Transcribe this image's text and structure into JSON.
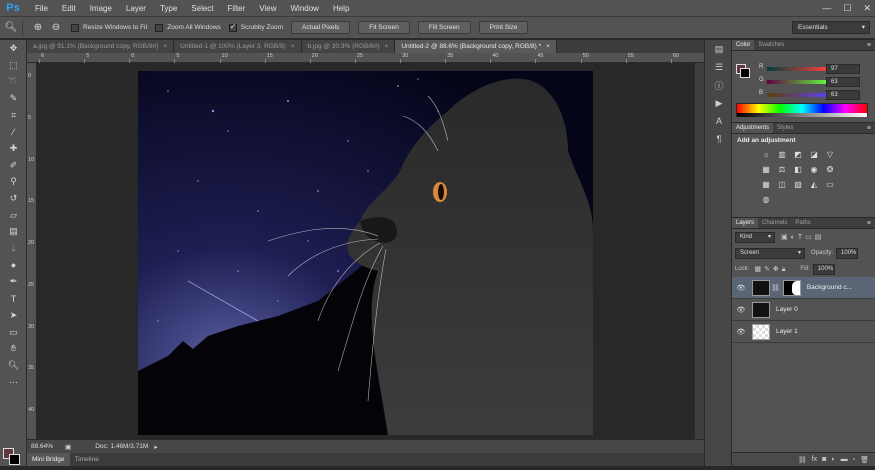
{
  "app": {
    "logo": "Ps"
  },
  "menu": [
    "File",
    "Edit",
    "Image",
    "Layer",
    "Type",
    "Select",
    "Filter",
    "View",
    "Window",
    "Help"
  ],
  "window_controls": {
    "minimize": "—",
    "maximize": "☐",
    "close": "✕"
  },
  "options": {
    "resize_windows": {
      "label": "Resize Windows to Fit",
      "checked": false
    },
    "zoom_all": {
      "label": "Zoom All Windows",
      "checked": false
    },
    "scrubby_zoom": {
      "label": "Scrubby Zoom",
      "checked": true
    },
    "actual_pixels": "Actual Pixels",
    "fit_screen": "Fit Screen",
    "fill_screen": "Fill Screen",
    "print_size": "Print Size",
    "workspace": "Essentials"
  },
  "doc_tabs": [
    {
      "label": "a.jpg @ 91.1% (Background copy, RGB/8#)",
      "close": "×",
      "active": false
    },
    {
      "label": "Untitled-1 @ 100% (Layer 3, RGB/8)",
      "close": "×",
      "active": false
    },
    {
      "label": "b.jpg @ 30.3% (RGB/8#)",
      "close": "×",
      "active": false
    },
    {
      "label": "Untitled-2 @ 88.6% (Background copy, RGB/8) *",
      "close": "×",
      "active": true
    }
  ],
  "ruler_top": [
    "6",
    "5",
    "0",
    "5",
    "10",
    "15",
    "20",
    "25",
    "30",
    "35",
    "40",
    "45",
    "50",
    "55",
    "60"
  ],
  "ruler_left": [
    "0",
    "5",
    "10",
    "15",
    "20",
    "25",
    "30",
    "35",
    "40"
  ],
  "status": {
    "zoom": "88.64%",
    "doc": "Doc: 1.46M/3.71M"
  },
  "bottom_tabs": [
    "Mini Bridge",
    "Timeline"
  ],
  "color_panel": {
    "tabs": [
      "Color",
      "Swatches"
    ],
    "fg_color": "#61383f",
    "bg_color": "#000000",
    "channels": [
      {
        "label": "R",
        "value": "97",
        "fraction": 0.38
      },
      {
        "label": "G",
        "value": "63",
        "fraction": 0.25
      },
      {
        "label": "B",
        "value": "63",
        "fraction": 0.25
      }
    ]
  },
  "adjustments": {
    "tabs": [
      "Adjustments",
      "Styles"
    ],
    "title": "Add an adjustment",
    "icons": [
      "brightness-icon",
      "levels-icon",
      "curves-icon",
      "exposure-icon",
      "vibrance-icon",
      "hue-saturation-icon",
      "color-balance-icon",
      "black-white-icon",
      "photo-filter-icon",
      "channel-mixer-icon",
      "color-lookup-icon",
      "invert-icon",
      "posterize-icon",
      "threshold-icon",
      "gradient-map-icon",
      "selective-color-icon"
    ]
  },
  "layers": {
    "tabs": [
      "Layers",
      "Channels",
      "Paths"
    ],
    "kind": "Kind",
    "blend_mode": "Screen",
    "opacity_label": "Opacity:",
    "opacity": "100%",
    "lock_label": "Lock:",
    "fill_label": "Fill:",
    "fill": "100%",
    "items": [
      {
        "name": "Background c...",
        "selected": true,
        "thumb": "dark",
        "mask": true
      },
      {
        "name": "Layer 0",
        "selected": false,
        "thumb": "dark",
        "mask": false
      },
      {
        "name": "Layer 1",
        "selected": false,
        "thumb": "checker",
        "mask": false
      }
    ]
  }
}
